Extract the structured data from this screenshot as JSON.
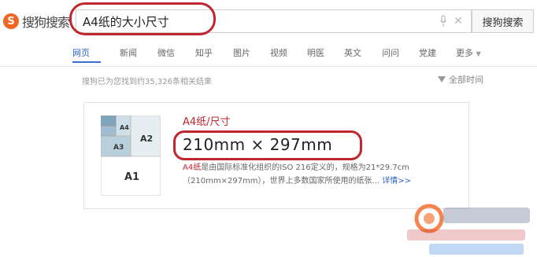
{
  "header": {
    "logo_badge": "S",
    "logo_text": "搜狗搜索",
    "search_value": "A4纸的大小尺寸",
    "search_button": "搜狗搜索"
  },
  "tabs": [
    "网页",
    "新闻",
    "微信",
    "知乎",
    "图片",
    "视频",
    "明医",
    "英文",
    "问问",
    "党建",
    "更多"
  ],
  "result_count": "搜狗已为您找到约35,326条相关结果",
  "filter": {
    "label": "全部时间"
  },
  "card": {
    "title": "A4纸/尺寸",
    "size": "210mm × 297mm",
    "desc_keyword": "A4纸",
    "desc_rest": "是由国际标准化组织的ISO 216定义的，规格为21*29.7cm（210mm×297mm），世界上多数国家所使用的纸张...",
    "details_link": "详情>>",
    "diagram_labels": [
      "A4",
      "A3",
      "A2",
      "A1"
    ]
  },
  "colors": {
    "accent_red": "#c0262d",
    "link_blue": "#2a62c2",
    "logo_orange": "#f26522"
  }
}
